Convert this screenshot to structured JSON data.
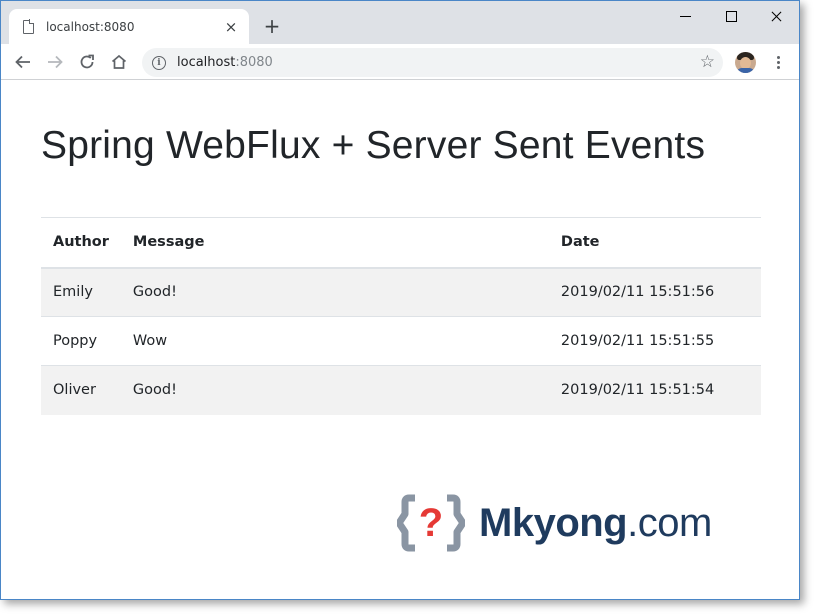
{
  "browser": {
    "tab": {
      "title": "localhost:8080",
      "close_glyph": "×"
    },
    "new_tab_glyph": "+",
    "address": {
      "host": "localhost",
      "port": ":8080"
    },
    "icons": [
      "page-icon",
      "back-icon",
      "forward-icon",
      "reload-icon",
      "home-icon",
      "info-icon",
      "star-icon",
      "avatar",
      "menu-icon",
      "minimize-icon",
      "maximize-icon",
      "close-icon"
    ]
  },
  "page": {
    "title": "Spring WebFlux + Server Sent Events",
    "table": {
      "headers": [
        "Author",
        "Message",
        "Date"
      ],
      "rows": [
        [
          "Emily",
          "Good!",
          "2019/02/11 15:51:56"
        ],
        [
          "Poppy",
          "Wow",
          "2019/02/11 15:51:55"
        ],
        [
          "Oliver",
          "Good!",
          "2019/02/11 15:51:54"
        ]
      ]
    }
  },
  "watermark": {
    "brand": "Mkyong",
    "suffix": ".com",
    "mark": "?"
  },
  "colors": {
    "accent_window_border": "#4a86c7",
    "logo_text": "#1f3b5e",
    "logo_red": "#e53935",
    "logo_gray": "#8a95a3"
  }
}
